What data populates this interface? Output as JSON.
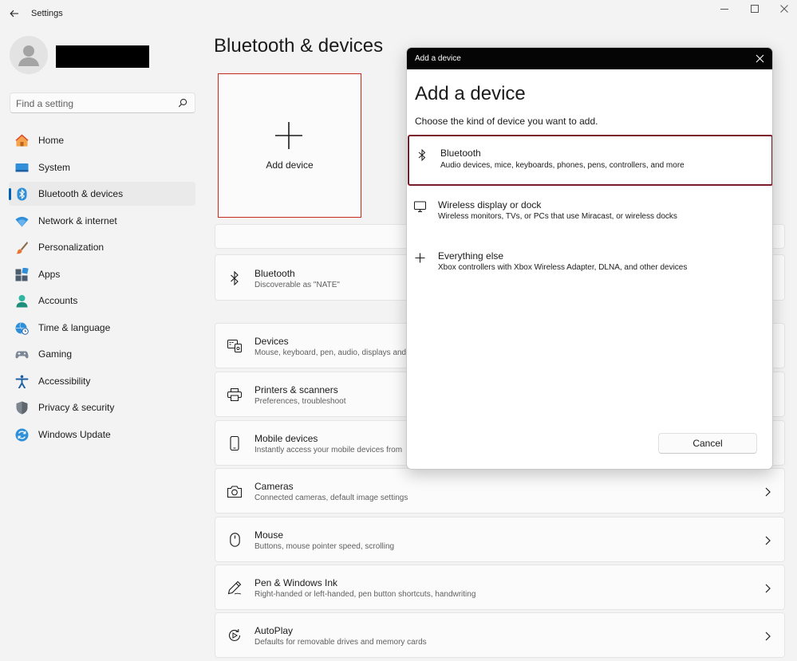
{
  "window": {
    "title": "Settings",
    "controls": [
      "minimize-icon",
      "maximize-icon",
      "close-icon"
    ]
  },
  "user": {
    "name": ""
  },
  "search": {
    "placeholder": "Find a setting"
  },
  "sidebar": {
    "items": [
      {
        "label": "Home",
        "icon": "home-icon"
      },
      {
        "label": "System",
        "icon": "system-icon"
      },
      {
        "label": "Bluetooth & devices",
        "icon": "bluetooth-icon",
        "selected": true
      },
      {
        "label": "Network & internet",
        "icon": "wifi-icon"
      },
      {
        "label": "Personalization",
        "icon": "brush-icon"
      },
      {
        "label": "Apps",
        "icon": "apps-icon"
      },
      {
        "label": "Accounts",
        "icon": "accounts-icon"
      },
      {
        "label": "Time & language",
        "icon": "globe-clock-icon"
      },
      {
        "label": "Gaming",
        "icon": "gamepad-icon"
      },
      {
        "label": "Accessibility",
        "icon": "accessibility-icon"
      },
      {
        "label": "Privacy & security",
        "icon": "shield-icon"
      },
      {
        "label": "Windows Update",
        "icon": "update-icon"
      }
    ]
  },
  "main": {
    "title": "Bluetooth & devices",
    "add_device_tile": "Add device",
    "bluetooth": {
      "title": "Bluetooth",
      "subtitle": "Discoverable as \"NATE\""
    },
    "rows": [
      {
        "title": "Devices",
        "subtitle": "Mouse, keyboard, pen, audio, displays and",
        "icon": "devices-icon"
      },
      {
        "title": "Printers & scanners",
        "subtitle": "Preferences, troubleshoot",
        "icon": "printer-icon"
      },
      {
        "title": "Mobile devices",
        "subtitle": "Instantly access your mobile devices from",
        "icon": "phone-icon"
      },
      {
        "title": "Cameras",
        "subtitle": "Connected cameras, default image settings",
        "icon": "camera-icon"
      },
      {
        "title": "Mouse",
        "subtitle": "Buttons, mouse pointer speed, scrolling",
        "icon": "mouse-icon"
      },
      {
        "title": "Pen & Windows Ink",
        "subtitle": "Right-handed or left-handed, pen button shortcuts, handwriting",
        "icon": "pen-icon"
      },
      {
        "title": "AutoPlay",
        "subtitle": "Defaults for removable drives and memory cards",
        "icon": "autoplay-icon"
      }
    ]
  },
  "dialog": {
    "caption": "Add a device",
    "heading": "Add a device",
    "description": "Choose the kind of device you want to add.",
    "options": [
      {
        "title": "Bluetooth",
        "subtitle": "Audio devices, mice, keyboards, phones, pens, controllers, and more",
        "icon": "bluetooth-icon",
        "selected": true
      },
      {
        "title": "Wireless display or dock",
        "subtitle": "Wireless monitors, TVs, or PCs that use Miracast, or wireless docks",
        "icon": "monitor-icon"
      },
      {
        "title": "Everything else",
        "subtitle": "Xbox controllers with Xbox Wireless Adapter, DLNA, and other devices",
        "icon": "plus-icon"
      }
    ],
    "cancel_label": "Cancel"
  },
  "colors": {
    "accent": "#005fb8",
    "selection_border": "#7a1a2a",
    "tile_border": "#c42b1c",
    "dialog_titlebar": "#050505"
  }
}
